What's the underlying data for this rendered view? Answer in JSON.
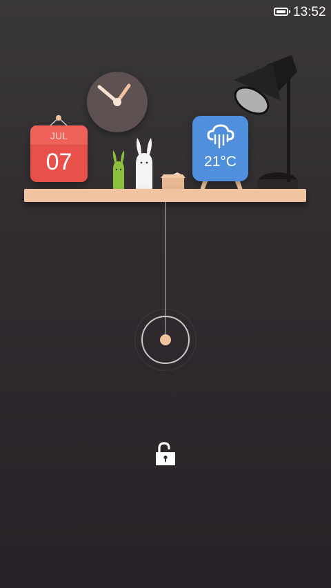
{
  "status_bar": {
    "time": "13:52",
    "battery_level": 1.0,
    "icons": [
      "battery-icon"
    ]
  },
  "widgets": {
    "calendar": {
      "month": "JUL",
      "day": "07",
      "color": "#e8514a"
    },
    "clock": {
      "icon": "clock-icon",
      "color": "#5d5152",
      "hour_hand_deg": -50,
      "minute_hand_deg": 35
    },
    "weather": {
      "temperature": "21°C",
      "icon": "rain-cloud-icon",
      "color": "#4f8fdc"
    }
  },
  "decor": {
    "items": [
      "green-bunny-figurine",
      "white-bunny-figurine",
      "small-box",
      "desk-lamp",
      "shelf"
    ],
    "shelf_color": "#f1c3a1"
  },
  "lock": {
    "icon": "unlock-icon",
    "slider": "pull-ring"
  }
}
